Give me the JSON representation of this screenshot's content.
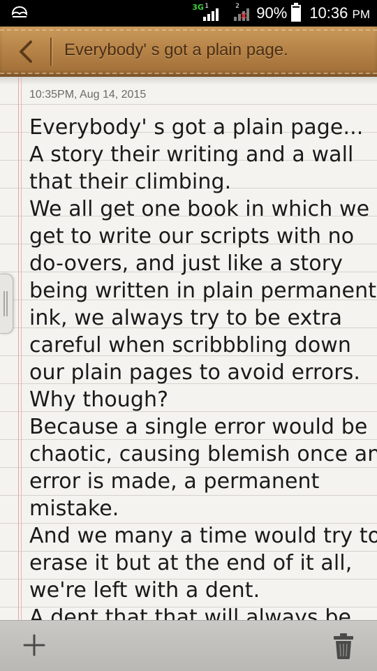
{
  "status_bar": {
    "network_1": "3G",
    "sim_1": "1",
    "sim_2": "2",
    "battery_percent_label": "90%",
    "battery_level": 0.9,
    "time": "10:36",
    "ampm": "PM"
  },
  "header": {
    "title": "Everybody' s got a plain page."
  },
  "note": {
    "timestamp": "10:35PM, Aug 14, 2015",
    "lines": [
      "Everybody' s got a plain page...",
      "A story their writing and a wall",
      "that their climbing.",
      "We all get one book in which we",
      "get to write our scripts with no",
      "do-overs, and just like a story",
      "being written in plain permanent",
      "ink, we always try to be extra",
      "careful when scribbbling down",
      "our plain pages to avoid errors.",
      "Why though?",
      "Because a single error would be",
      "chaotic, causing blemish once an",
      "error is made, a permanent",
      "mistake.",
      "And we many a time would try to",
      "erase it but at the end of it all,",
      "we're left with a dent.",
      "A dent that that will always be"
    ]
  },
  "icons": {
    "back": "chevron-left-icon",
    "add": "plus-icon",
    "delete": "trash-icon"
  },
  "colors": {
    "leather": "#b9864a",
    "paper": "#f4f3ef",
    "margin_line": "#e2a6a6",
    "bottom_bar": "#c2c1bd"
  }
}
